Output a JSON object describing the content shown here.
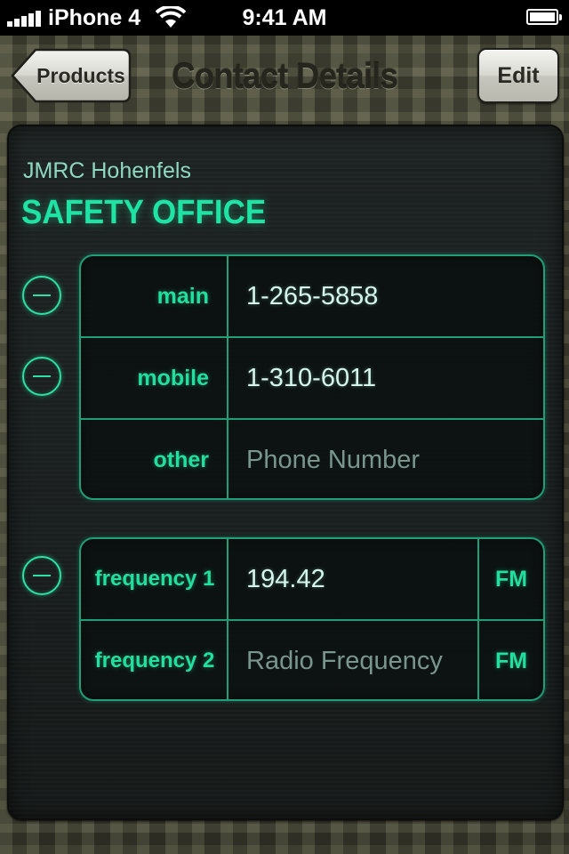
{
  "status_bar": {
    "carrier": "iPhone 4",
    "time": "9:41 AM"
  },
  "nav": {
    "back_label": "Products",
    "title": "Contact Details",
    "edit_label": "Edit"
  },
  "contact": {
    "organization": "JMRC Hohenfels",
    "name": "SAFETY OFFICE"
  },
  "phones": [
    {
      "label": "main",
      "value": "1-265-5858"
    },
    {
      "label": "mobile",
      "value": "1-310-6011"
    },
    {
      "label": "other",
      "placeholder": "Phone Number"
    }
  ],
  "frequencies": [
    {
      "label": "frequency 1",
      "value": "194.42",
      "band": "FM"
    },
    {
      "label": "frequency 2",
      "placeholder": "Radio Frequency",
      "band": "FM"
    }
  ],
  "colors": {
    "accent_green": "#22df9f",
    "panel_bg": "#1a1f1f",
    "nav_text": "#26261e"
  },
  "icons": [
    "signal-icon",
    "wifi-icon",
    "battery-icon",
    "back-arrow-icon",
    "minus-circle-icon"
  ]
}
